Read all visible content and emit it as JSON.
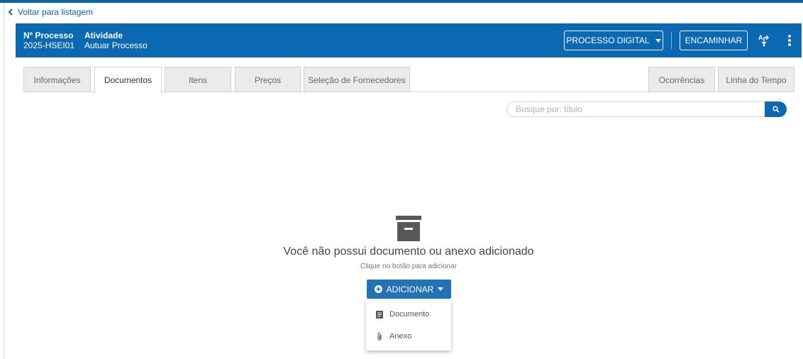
{
  "nav": {
    "back_label": "Voltar para listagem"
  },
  "header": {
    "processo_label": "Nº Processo",
    "processo_value": "2025-HSEI01",
    "atividade_label": "Atividade",
    "atividade_value": "Autuar Processo",
    "processo_digital_label": "PROCESSO DIGITAL",
    "encaminhar_label": "ENCAMINHAR"
  },
  "tabs": [
    {
      "label": "Informações",
      "active": false
    },
    {
      "label": "Documentos",
      "active": true
    },
    {
      "label": "Itens",
      "active": false
    },
    {
      "label": "Preços",
      "active": false
    },
    {
      "label": "Seleção de Fornecedores",
      "active": false
    },
    {
      "label": "Ocorrências",
      "active": false
    },
    {
      "label": "Linha do Tempo",
      "active": false
    }
  ],
  "search": {
    "placeholder": "Busque por: título",
    "value": ""
  },
  "empty_state": {
    "icon": "archive-box-icon",
    "title": "Você não possui documento ou anexo adicionado",
    "subtitle": "Clique no botão para adicionar"
  },
  "add_button": {
    "label": "ADICIONAR",
    "icon": "plus-circle-icon"
  },
  "add_menu": {
    "items": [
      {
        "label": "Documento",
        "icon": "document-icon"
      },
      {
        "label": "Anexo",
        "icon": "paperclip-icon"
      }
    ]
  },
  "colors": {
    "primary": "#0b68b2",
    "button": "#2273b6",
    "link": "#0a64ad",
    "tab_inactive": "#ebebeb"
  }
}
